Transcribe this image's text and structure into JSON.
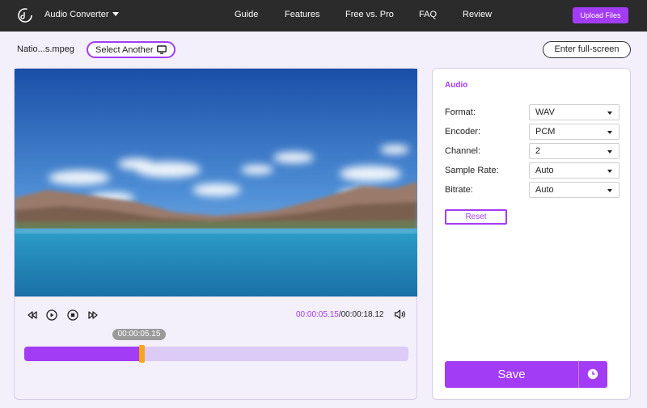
{
  "header": {
    "app_title": "Audio Converter",
    "nav": [
      "Guide",
      "Features",
      "Free vs. Pro",
      "FAQ",
      "Review"
    ],
    "upload_label": "Upload Files"
  },
  "file": {
    "name": "Natio...s.mpeg",
    "select_another_label": "Select Another",
    "fullscreen_label": "Enter full-screen"
  },
  "player": {
    "current_time": "00:00:05.15",
    "separator": "/",
    "total_time": "00:00:18.12",
    "tooltip_time": "00:00:05.15",
    "progress_fraction": 0.305
  },
  "settings": {
    "title": "Audio",
    "fields": [
      {
        "label": "Format:",
        "value": "WAV"
      },
      {
        "label": "Encoder:",
        "value": "PCM"
      },
      {
        "label": "Channel:",
        "value": "2"
      },
      {
        "label": "Sample Rate:",
        "value": "Auto"
      },
      {
        "label": "Bitrate:",
        "value": "Auto"
      }
    ],
    "reset_label": "Reset",
    "save_label": "Save"
  },
  "colors": {
    "accent": "#a33cf5",
    "handle": "#f8a51c",
    "topbar": "#2b2b2b"
  }
}
